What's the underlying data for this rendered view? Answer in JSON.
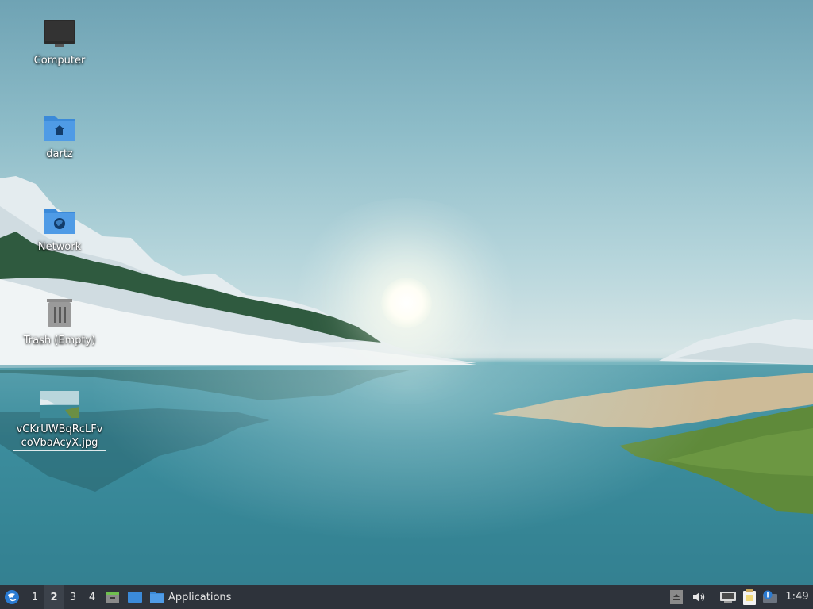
{
  "desktop": {
    "icons": [
      {
        "label": "Computer",
        "icon": "monitor-icon"
      },
      {
        "label": "dartz",
        "icon": "home-folder-icon"
      },
      {
        "label": "Network",
        "icon": "network-folder-icon"
      },
      {
        "label": "Trash (Empty)",
        "icon": "trash-icon"
      },
      {
        "label": "vCKrUWBqRcLFv coVbaAcyX.jpg",
        "icon": "image-thumbnail-icon"
      }
    ]
  },
  "panel": {
    "menu_icon": "lxqt-logo-icon",
    "workspaces": [
      "1",
      "2",
      "3",
      "4"
    ],
    "active_workspace": "2",
    "quicklaunch": [
      "file-manager-icon",
      "desktop-icon"
    ],
    "task": {
      "label": "Applications",
      "icon": "folder-icon"
    },
    "tray": [
      "eject-icon",
      "volume-icon",
      "network-icon",
      "clipboard-icon",
      "update-notifier-icon"
    ],
    "clock": "1:49"
  },
  "colors": {
    "panel_bg": "#2e333b",
    "folder_blue": "#3b8ad9"
  }
}
